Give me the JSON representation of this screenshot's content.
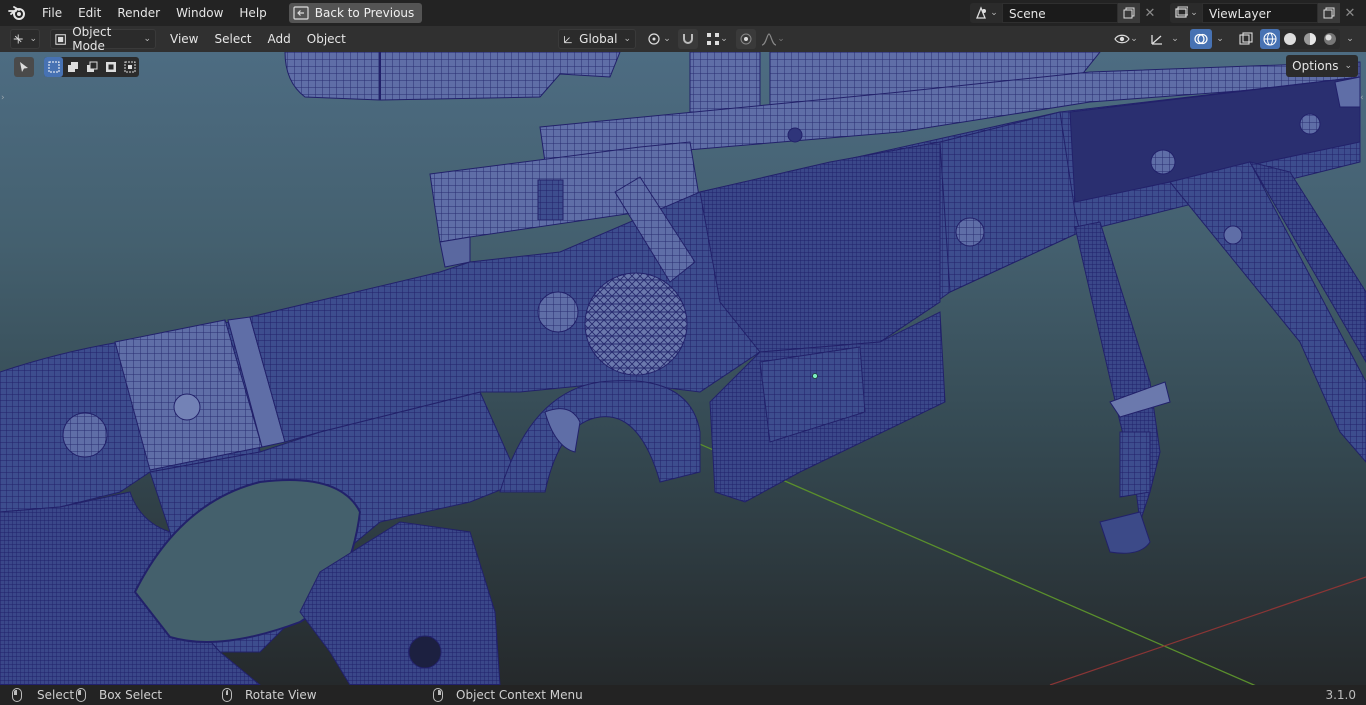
{
  "topbar": {
    "menus": [
      "File",
      "Edit",
      "Render",
      "Window",
      "Help"
    ],
    "back_label": "Back to Previous",
    "scene_name": "Scene",
    "view_layer": "ViewLayer"
  },
  "header": {
    "mode_label": "Object Mode",
    "menus": [
      "View",
      "Select",
      "Add",
      "Object"
    ],
    "transform_orientation": "Global"
  },
  "viewport": {
    "options_label": "Options"
  },
  "status": {
    "select": "Select",
    "box_select": "Box Select",
    "rotate_view": "Rotate View",
    "context_menu": "Object Context Menu",
    "version": "3.1.0"
  },
  "colors": {
    "accent": "#4772b3",
    "wire": "#24236b",
    "mesh_fill": "#3a4a8a",
    "grid_green": "#4f8a2a",
    "grid_red": "#8a2f2f"
  }
}
